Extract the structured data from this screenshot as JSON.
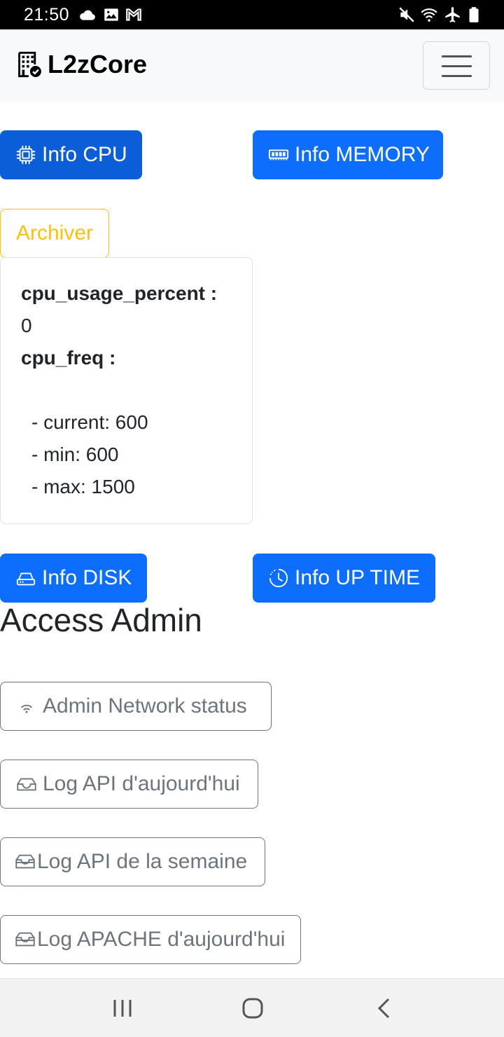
{
  "status_bar": {
    "time": "21:50",
    "left_icons": [
      "cloud-icon",
      "image-icon",
      "gmail-icon"
    ],
    "right_icons": [
      "mute-icon",
      "wifi-icon",
      "airplane-icon",
      "battery-icon"
    ]
  },
  "navbar": {
    "brand": "L2zCore",
    "brand_icon": "building-check-icon",
    "toggler_icon": "hamburger-icon"
  },
  "buttons": {
    "info_cpu": "Info CPU",
    "info_memory": "Info MEMORY",
    "archiver": "Archiver",
    "info_disk": "Info DISK",
    "info_uptime": "Info UP TIME"
  },
  "cpu_card": {
    "usage_label": "cpu_usage_percent :",
    "usage_value": "0",
    "freq_label": "cpu_freq :",
    "current": "- current: 600",
    "min": "- min: 600",
    "max": "- max: 1500"
  },
  "admin": {
    "title": "Access Admin",
    "network_status": "Admin Network status",
    "log_api_today": "Log API d'aujourd'hui",
    "log_api_week": "Log API de la semaine",
    "log_apache_today": "Log APACHE d'aujourd'hui"
  },
  "colors": {
    "primary": "#0d6efd",
    "primary_active": "#0b5ed7",
    "warning": "#ffc107",
    "secondary": "#6c757d"
  }
}
